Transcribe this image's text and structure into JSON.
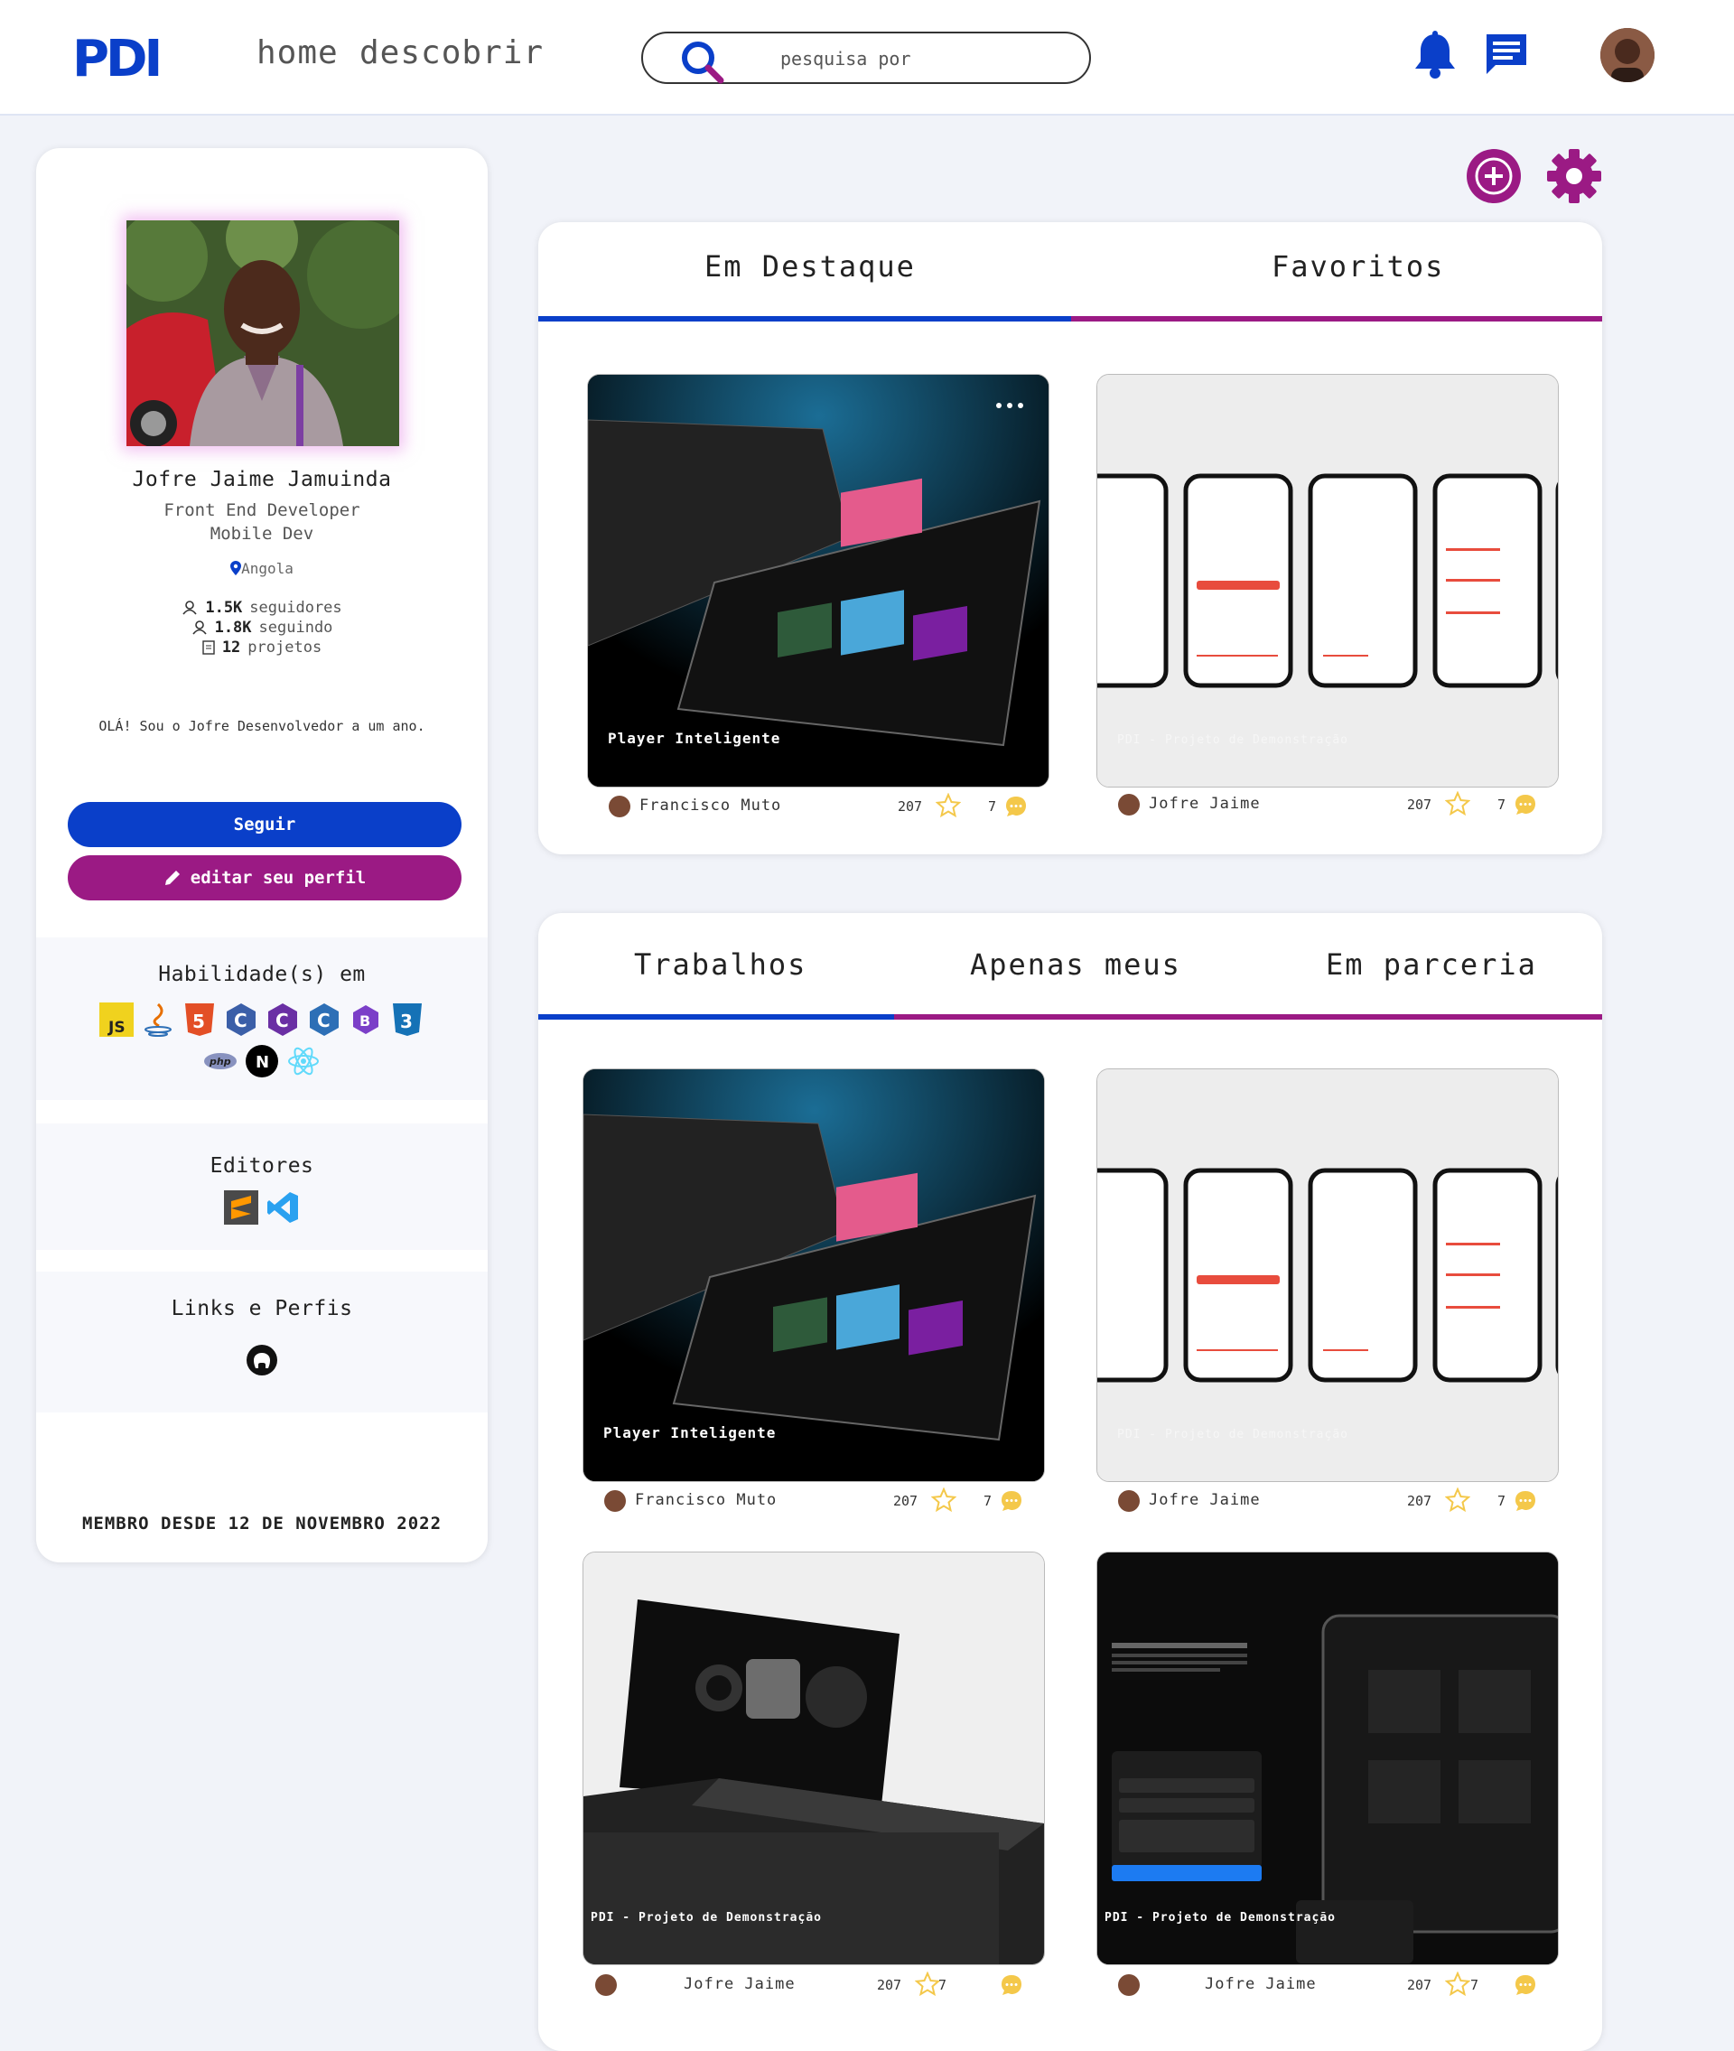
{
  "header": {
    "logo_text": "PDI",
    "nav": [
      "home",
      "descobrir"
    ],
    "search_placeholder": "pesquisa por"
  },
  "colors": {
    "primary_blue": "#0a3fc9",
    "accent_purple": "#9b1a84",
    "star": "#f4c84a"
  },
  "profile": {
    "name": "Jofre Jaime Jamuinda",
    "role": "Front End Developer\nMobile Dev",
    "location": "Angola",
    "followers_count": "1.5K",
    "followers_label": "seguidores",
    "following_count": "1.8K",
    "following_label": "seguindo",
    "projects_count": "12",
    "projects_label": "projetos",
    "bio": "OLÁ! Sou o Jofre Desenvolvedor a um ano.",
    "follow_button": "Seguir",
    "edit_button": "editar seu perfil",
    "skills_title": "Habilidade(s) em",
    "skills": [
      "JS",
      "java",
      "html5",
      "c",
      "c#",
      "c++",
      "bootstrap",
      "css3",
      "php",
      "next",
      "react"
    ],
    "editors_title": "Editores",
    "editors": [
      "sublime",
      "vscode"
    ],
    "links_title": "Links e Perfis",
    "links": [
      "github"
    ],
    "member_since": "MEMBRO DESDE 12 DE NOVEMBRO 2022"
  },
  "featured": {
    "tabs": [
      "Em Destaque",
      "Favoritos"
    ],
    "projects": [
      {
        "title": "Player Inteligente",
        "author": "Francisco Muto",
        "likes": "207",
        "comments": "7"
      },
      {
        "title": "PDI - Projeto de Demonstração",
        "author": "Jofre Jaime",
        "likes": "207",
        "comments": "7"
      }
    ]
  },
  "works": {
    "tabs": [
      "Trabalhos",
      "Apenas meus",
      "Em parceria"
    ],
    "projects": [
      {
        "title": "Player Inteligente",
        "author": "Francisco Muto",
        "likes": "207",
        "comments": "7"
      },
      {
        "title": "PDI - Projeto de Demonstração",
        "author": "Jofre Jaime",
        "likes": "207",
        "comments": "7"
      },
      {
        "title": "PDI - Projeto de Demonstração",
        "author": "Jofre Jaime",
        "likes": "207",
        "comments": "7"
      },
      {
        "title": "PDI - Projeto de Demonstração",
        "author": "Jofre Jaime",
        "likes": "207",
        "comments": "7"
      }
    ]
  }
}
